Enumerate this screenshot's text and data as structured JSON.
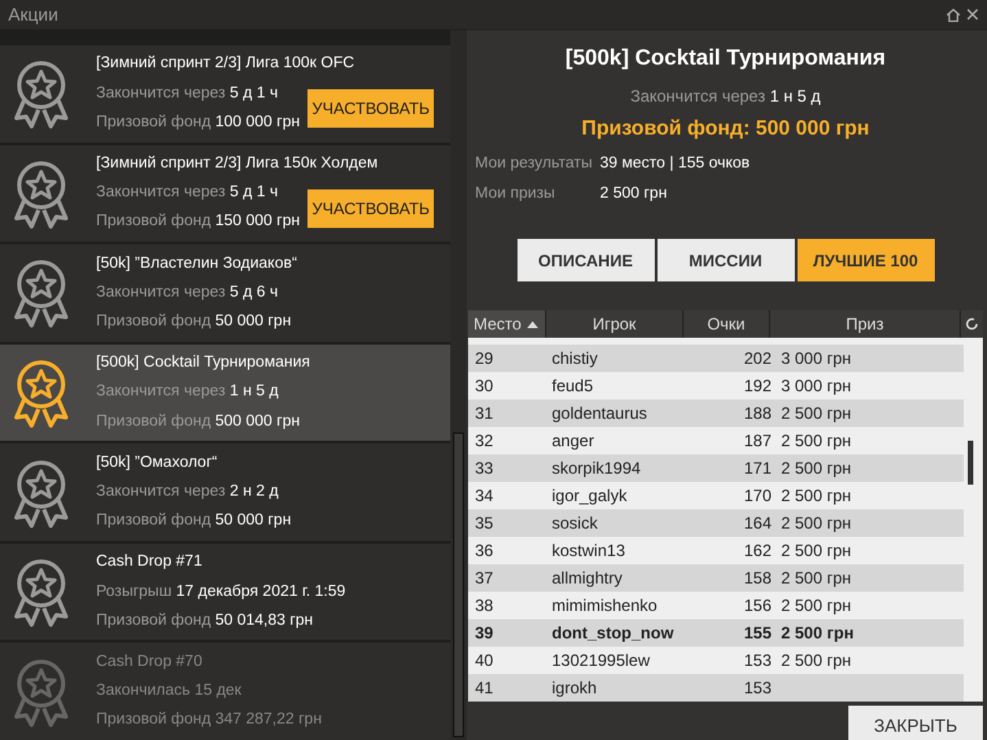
{
  "window": {
    "title": "Акции"
  },
  "promotions": [
    {
      "title": "[Зимний спринт 2/3] Лига 100к OFC",
      "line1_label": "Закончится через",
      "line1_value": "5 д 1 ч",
      "line2_label": "Призовой фонд",
      "line2_value": "100 000 грн",
      "button": "УЧАСТВОВАТЬ",
      "selected": false,
      "finished": false
    },
    {
      "title": "[Зимний спринт 2/3] Лига 150к Холдем",
      "line1_label": "Закончится через",
      "line1_value": "5 д 1 ч",
      "line2_label": "Призовой фонд",
      "line2_value": "150 000 грн",
      "button": "УЧАСТВОВАТЬ",
      "selected": false,
      "finished": false
    },
    {
      "title": "[50k] ”Властелин Зодиаков“",
      "line1_label": "Закончится через",
      "line1_value": "5 д 6 ч",
      "line2_label": "Призовой фонд",
      "line2_value": "50 000 грн",
      "selected": false,
      "finished": false
    },
    {
      "title": "[500k] Cocktail Турниромания",
      "line1_label": "Закончится через",
      "line1_value": "1 н 5 д",
      "line2_label": "Призовой фонд",
      "line2_value": "500 000 грн",
      "selected": true,
      "finished": false
    },
    {
      "title": "[50k] ”Омахолог“",
      "line1_label": "Закончится через",
      "line1_value": "2 н 2 д",
      "line2_label": "Призовой фонд",
      "line2_value": "50 000 грн",
      "selected": false,
      "finished": false
    },
    {
      "title": "Cash Drop #71",
      "line1_label": "Розыгрыш",
      "line1_value": "17 декабря 2021 г. 1:59",
      "line2_label": "Призовой фонд",
      "line2_value": "50 014,83 грн",
      "selected": false,
      "finished": false
    },
    {
      "title": "Cash Drop #70",
      "line1_label": "Закончилась",
      "line1_value": "15 дек",
      "line2_label": "Призовой фонд",
      "line2_value": "347 287,22 грн",
      "selected": false,
      "finished": true
    }
  ],
  "detail": {
    "title": "[500k] Cocktail Турниромания",
    "ends_label": "Закончится через",
    "ends_value": "1 н 5 д",
    "prize_fund": "Призовой фонд: 500 000 грн",
    "results_label": "Мои результаты",
    "results_value": "39 место | 155 очков",
    "prizes_label": "Мои призы",
    "prizes_value": "2 500 грн"
  },
  "tabs": [
    {
      "label": "ОПИСАНИЕ",
      "selected": false
    },
    {
      "label": "МИССИИ",
      "selected": false
    },
    {
      "label": "ЛУЧШИЕ 100",
      "selected": true
    }
  ],
  "table": {
    "columns": [
      "Место",
      "Игрок",
      "Очки",
      "Приз"
    ],
    "rows": [
      {
        "place": "29",
        "player": "chistiy",
        "points": "202",
        "prize": "3 000 грн",
        "mine": false
      },
      {
        "place": "30",
        "player": "feud5",
        "points": "192",
        "prize": "3 000 грн",
        "mine": false
      },
      {
        "place": "31",
        "player": "goldentaurus",
        "points": "188",
        "prize": "2 500 грн",
        "mine": false
      },
      {
        "place": "32",
        "player": "anger",
        "points": "187",
        "prize": "2 500 грн",
        "mine": false
      },
      {
        "place": "33",
        "player": "skorpik1994",
        "points": "171",
        "prize": "2 500 грн",
        "mine": false
      },
      {
        "place": "34",
        "player": "igor_galyk",
        "points": "170",
        "prize": "2 500 грн",
        "mine": false
      },
      {
        "place": "35",
        "player": "sosick",
        "points": "164",
        "prize": "2 500 грн",
        "mine": false
      },
      {
        "place": "36",
        "player": "kostwin13",
        "points": "162",
        "prize": "2 500 грн",
        "mine": false
      },
      {
        "place": "37",
        "player": "allmightry",
        "points": "158",
        "prize": "2 500 грн",
        "mine": false
      },
      {
        "place": "38",
        "player": "mimimishenko",
        "points": "156",
        "prize": "2 500 грн",
        "mine": false
      },
      {
        "place": "39",
        "player": "dont_stop_now",
        "points": "155",
        "prize": "2 500 грн",
        "mine": true
      },
      {
        "place": "40",
        "player": "13021995lew",
        "points": "153",
        "prize": "2 500 грн",
        "mine": false
      },
      {
        "place": "41",
        "player": "igrokh",
        "points": "153",
        "mine": false
      }
    ]
  },
  "close_button": "ЗАКРЫТЬ"
}
